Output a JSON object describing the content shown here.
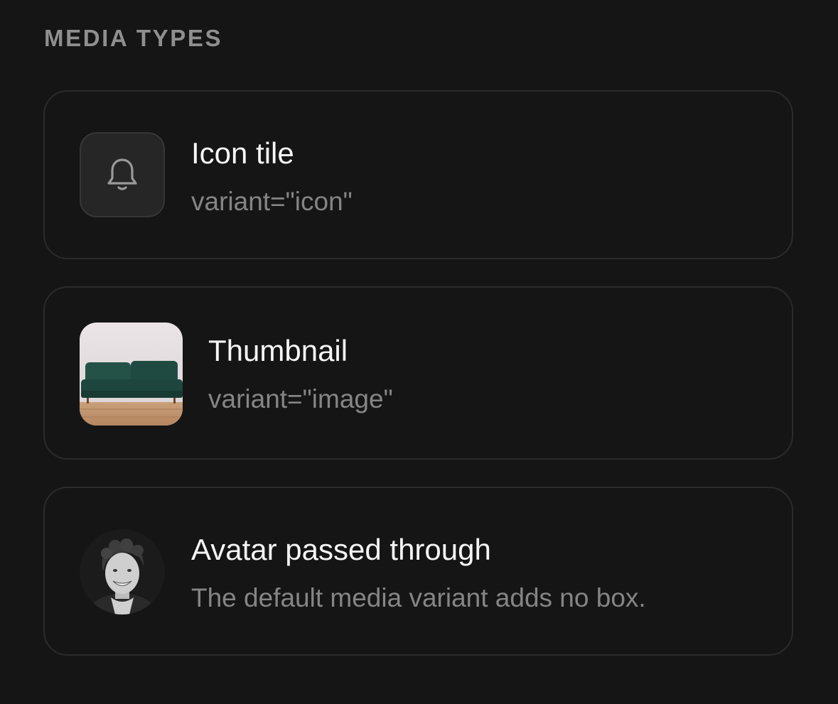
{
  "section": {
    "title": "MEDIA TYPES"
  },
  "items": [
    {
      "media": "bell-icon",
      "title": "Icon tile",
      "subtitle": "variant=\"icon\""
    },
    {
      "media": "sofa-thumbnail-image",
      "title": "Thumbnail",
      "subtitle": "variant=\"image\""
    },
    {
      "media": "person-avatar-image",
      "title": "Avatar passed through",
      "subtitle": "The default media variant adds no box."
    }
  ],
  "colors": {
    "background": "#151515",
    "card_border": "#2b2b2b",
    "title": "#f5f5f5",
    "subtitle": "#858585",
    "section_title": "#8f8f8f",
    "icon_tile_bg": "#262626",
    "sofa_green": "#1f4a42"
  }
}
